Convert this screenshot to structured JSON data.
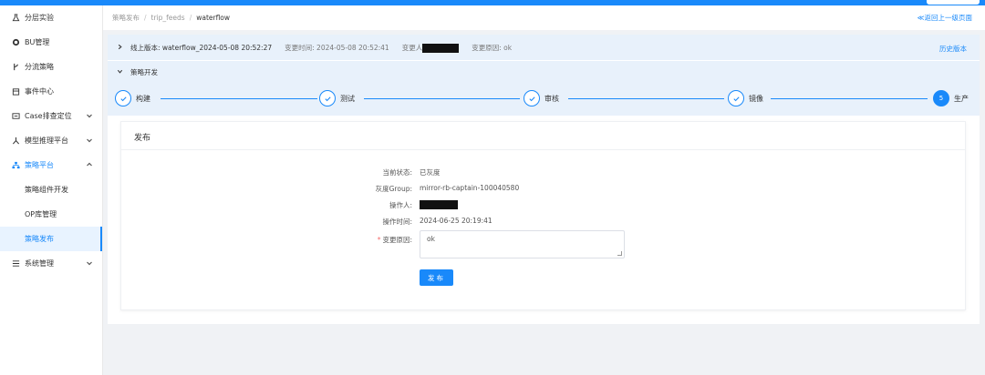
{
  "sidebar": {
    "items": [
      {
        "label": "分层实验",
        "icon": "flask-icon"
      },
      {
        "label": "BU管理",
        "icon": "globe-icon"
      },
      {
        "label": "分流策略",
        "icon": "branch-icon"
      },
      {
        "label": "事件中心",
        "icon": "calendar-icon"
      },
      {
        "label": "Case排查定位",
        "icon": "monitor-icon",
        "has_arrow": true
      },
      {
        "label": "模型推理平台",
        "icon": "model-icon",
        "has_arrow": true
      },
      {
        "label": "策略平台",
        "icon": "sitemap-icon",
        "has_arrow": true,
        "expanded": true
      }
    ],
    "subitems": [
      {
        "label": "策略组件开发"
      },
      {
        "label": "OP库管理"
      },
      {
        "label": "策略发布",
        "selected": true
      }
    ],
    "last_item": {
      "label": "系统管理",
      "icon": "list-icon"
    }
  },
  "breadcrumb": {
    "items": [
      "策略发布",
      "trip_feeds",
      "waterflow"
    ],
    "back_label": "≪返回上一级页面"
  },
  "infobar": {
    "version_label": "线上版本: waterflow_2024-05-08 20:52:27",
    "change_time": "变更时间: 2024-05-08 20:52:41",
    "changer_label": "变更人",
    "reason": "变更原因: ok",
    "history_label": "历史版本"
  },
  "section": {
    "title": "策略开发"
  },
  "steps": [
    {
      "label": "构建",
      "status": "done"
    },
    {
      "label": "测试",
      "status": "done"
    },
    {
      "label": "审核",
      "status": "done"
    },
    {
      "label": "镜像",
      "status": "done"
    },
    {
      "label": "生产",
      "status": "active",
      "number": "5"
    }
  ],
  "publish_panel": {
    "title": "发布",
    "status_label": "当前状态:",
    "status_value": "已灰度",
    "group_label": "灰度Group:",
    "group_value": "mirror-rb-captain-100040580",
    "operator_label": "操作人:",
    "time_label": "操作时间:",
    "time_value": "2024-06-25 20:19:41",
    "reason_label": "变更原因:",
    "reason_value": "ok",
    "publish_button": "发布"
  },
  "colors": {
    "primary": "#1989fa",
    "light_bg": "#e8f1fb",
    "required": "#f56c6c"
  }
}
